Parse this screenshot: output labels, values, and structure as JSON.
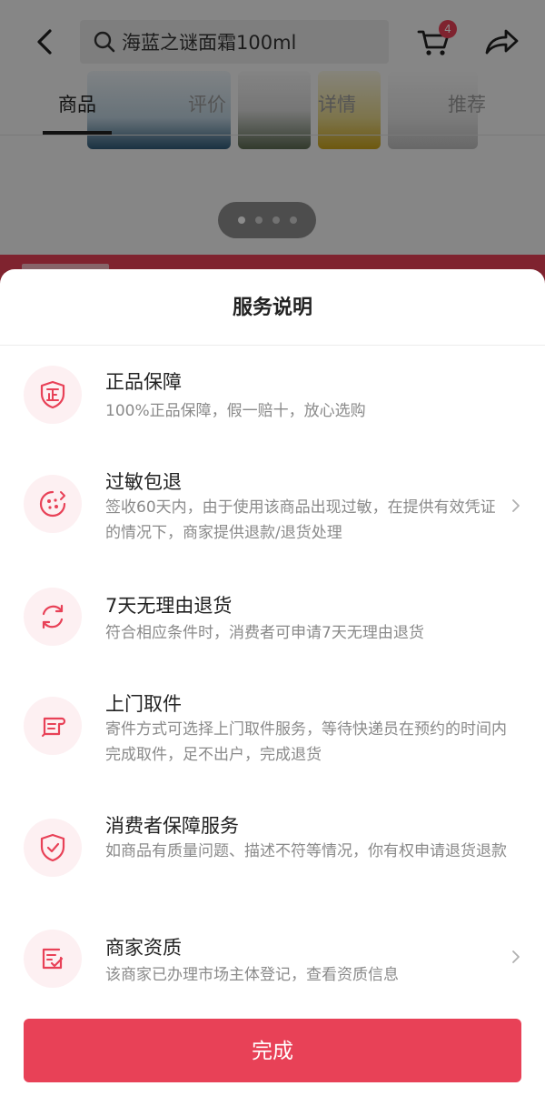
{
  "header": {
    "search_text": "海蓝之谜面霜100ml",
    "cart_count": "4"
  },
  "tabs": [
    {
      "label": "商品",
      "active": true
    },
    {
      "label": "评价",
      "active": false
    },
    {
      "label": "详情",
      "active": false
    },
    {
      "label": "推荐",
      "active": false
    }
  ],
  "carousel": {
    "page_count": 4,
    "current_page": 1
  },
  "sheet": {
    "title": "服务说明",
    "services": [
      {
        "icon": "genuine-shield-icon",
        "title": "正品保障",
        "desc": "100%正品保障，假一赔十，放心选购",
        "has_chevron": false
      },
      {
        "icon": "allergy-icon",
        "title": "过敏包退",
        "desc": "签收60天内，由于使用该商品出现过敏，在提供有效凭证的情况下，商家提供退款/退货处理",
        "has_chevron": true
      },
      {
        "icon": "refresh-icon",
        "title": "7天无理由退货",
        "desc": "符合相应条件时，消费者可申请7天无理由退货",
        "has_chevron": false
      },
      {
        "icon": "pickup-icon",
        "title": "上门取件",
        "desc": "寄件方式可选择上门取件服务，等待快递员在预约的时间内完成取件，足不出户，完成退货",
        "has_chevron": false
      },
      {
        "icon": "consumer-protection-icon",
        "title": "消费者保障服务",
        "desc": "如商品有质量问题、描述不符等情况，你有权申请退货退款",
        "has_chevron": false
      },
      {
        "icon": "merchant-license-icon",
        "title": "商家资质",
        "desc": "该商家已办理市场主体登记，查看资质信息",
        "has_chevron": true
      }
    ],
    "done_label": "完成"
  },
  "colors": {
    "accent": "#e84157",
    "icon_bg": "#fdf0f2"
  }
}
